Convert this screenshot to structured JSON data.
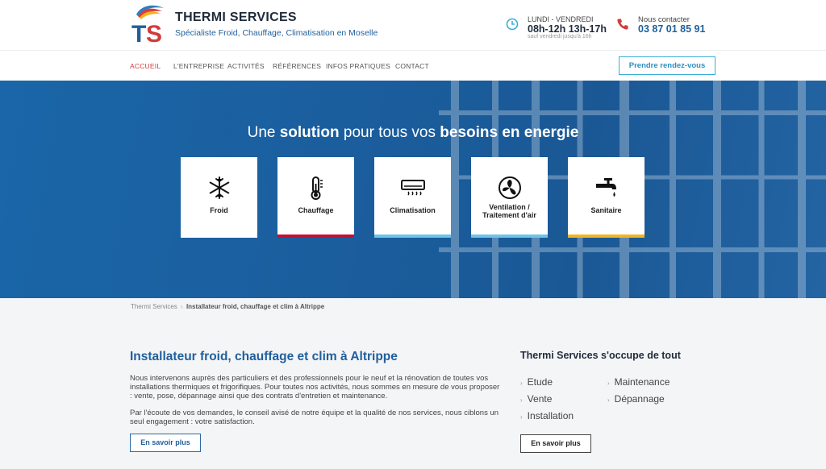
{
  "header": {
    "brand_name": "THERMI SERVICES",
    "tagline": "Spécialiste Froid, Chauffage, Climatisation en Moselle",
    "hours_days": "LUNDI - VENDREDI",
    "hours_time": "08h-12h 13h-17h",
    "hours_note": "sauf vendredi jusqu'à 16h",
    "contact_label": "Nous contacter",
    "contact_phone": "03 87 01 85 91",
    "logo_text": "TS"
  },
  "nav": {
    "items": [
      "ACCUEIL",
      "L'ENTREPRISE",
      "ACTIVITÉS",
      "RÉFÉRENCES",
      "INFOS PRATIQUES",
      "CONTACT"
    ],
    "active": "ACCUEIL",
    "cta": "Prendre rendez-vous"
  },
  "hero": {
    "title_pre": "Une",
    "title_b1": "solution",
    "title_mid": "pour tous vos",
    "title_b2": "besoins en energie",
    "cards": [
      {
        "label": "Froid",
        "icon": "snowflake-icon",
        "bar_color": "#ffffff"
      },
      {
        "label": "Chauffage",
        "icon": "thermometer-icon",
        "bar_color": "#c8102e"
      },
      {
        "label": "Climatisation",
        "icon": "air-conditioner-icon",
        "bar_color": "#6cc4e8"
      },
      {
        "label_line1": "Ventilation /",
        "label_line2": "Traitement d'air",
        "icon": "fan-icon",
        "bar_color": "#6cc4e8"
      },
      {
        "label": "Sanitaire",
        "icon": "faucet-icon",
        "bar_color": "#f2b51d"
      }
    ]
  },
  "breadcrumb": {
    "home": "Thermi Services",
    "separator": "›",
    "current": "Installateur froid, chauffage et clim à Altrippe"
  },
  "main": {
    "title": "Installateur froid, chauffage et clim à Altrippe",
    "para1": "Nous intervenons auprès des particuliers et des professionnels pour le neuf et la rénovation de toutes vos installations thermiques et frigorifiques. Pour toutes nos activités, nous sommes en mesure de vous proposer : vente, pose, dépannage ainsi que des contrats d'entretien et maintenance.",
    "para2": "Par l'écoute de vos demandes, le conseil avisé de notre équipe et la qualité de nos services, nous ciblons un seul engagement : votre satisfaction.",
    "button": "En savoir plus"
  },
  "sidebar": {
    "title": "Thermi Services s'occupe de tout",
    "services_col1": [
      "Etude",
      "Vente",
      "Installation"
    ],
    "services_col2": [
      "Maintenance",
      "Dépannage"
    ],
    "button": "En savoir plus"
  },
  "colors": {
    "brand_blue": "#1f5f9c",
    "accent_red": "#c8102e",
    "accent_cyan": "#3aaed8",
    "accent_yellow": "#f2b51d"
  }
}
